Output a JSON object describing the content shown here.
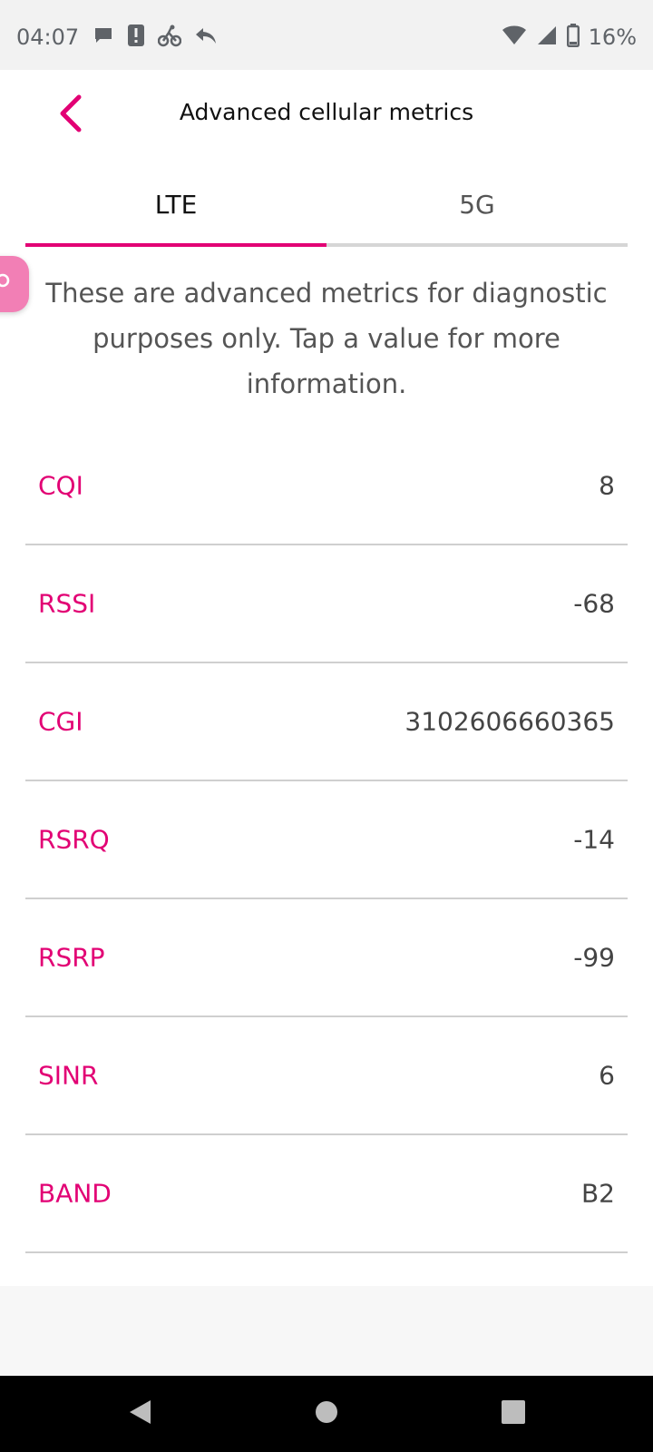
{
  "status_bar": {
    "time": "04:07",
    "battery": "16%",
    "left_icons": [
      "chat-bubble-icon",
      "alert-icon",
      "bike-icon",
      "reply-icon"
    ],
    "right_icons": [
      "wifi-icon",
      "cell-signal-icon",
      "battery-icon"
    ]
  },
  "header": {
    "title": "Advanced cellular metrics",
    "back_icon": "chevron-left-icon"
  },
  "tabs": [
    {
      "label": "LTE",
      "selected": true
    },
    {
      "label": "5G",
      "selected": false
    }
  ],
  "intro_text": "These are advanced metrics for diagnostic purposes only. Tap a value for more information.",
  "metrics": [
    {
      "label": "CQI",
      "value": "8"
    },
    {
      "label": "RSSI",
      "value": "-68"
    },
    {
      "label": "CGI",
      "value": "3102606660365"
    },
    {
      "label": "RSRQ",
      "value": "-14"
    },
    {
      "label": "RSRP",
      "value": "-99"
    },
    {
      "label": "SINR",
      "value": "6"
    },
    {
      "label": "BAND",
      "value": "B2"
    }
  ],
  "colors": {
    "accent": "#e20074",
    "fab": "#f27fb5",
    "text_dark": "#111111",
    "text_muted": "#555555",
    "divider": "#cfcfcf"
  }
}
